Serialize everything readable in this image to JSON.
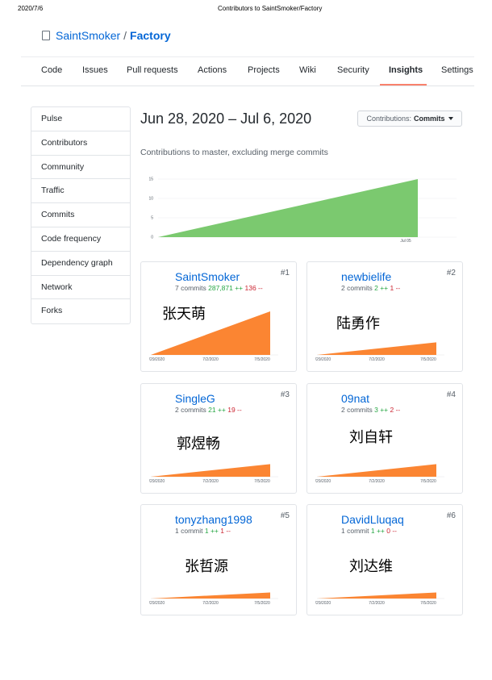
{
  "print_header": {
    "date": "2020/7/6",
    "title": "Contributors to SaintSmoker/Factory"
  },
  "repo": {
    "owner": "SaintSmoker",
    "separator": "/",
    "name": "Factory"
  },
  "tabs": [
    {
      "label": "Code"
    },
    {
      "label": "Issues"
    },
    {
      "label": "Pull requests"
    },
    {
      "label": "Actions"
    },
    {
      "label": "Projects"
    },
    {
      "label": "Wiki"
    },
    {
      "label": "Security"
    },
    {
      "label": "Insights"
    },
    {
      "label": "Settings"
    }
  ],
  "active_tab": "Insights",
  "sidebar": {
    "items": [
      {
        "label": "Pulse"
      },
      {
        "label": "Contributors"
      },
      {
        "label": "Community"
      },
      {
        "label": "Traffic"
      },
      {
        "label": "Commits"
      },
      {
        "label": "Code frequency"
      },
      {
        "label": "Dependency graph"
      },
      {
        "label": "Network"
      },
      {
        "label": "Forks"
      }
    ]
  },
  "main": {
    "date_range": "Jun 28, 2020 – Jul 6, 2020",
    "contrib_button": {
      "prefix": "Contributions:",
      "value": "Commits"
    },
    "subtitle": "Contributions to master, excluding merge commits"
  },
  "chart_data": {
    "type": "area",
    "y_ticks": [
      "15",
      "10",
      "5",
      "0"
    ],
    "x_ticks": [
      "Jul 05"
    ],
    "ylim": [
      0,
      15
    ],
    "points": [
      [
        "Jun 28",
        0
      ],
      [
        "Jul 6",
        15
      ]
    ],
    "color": "#7bc96f"
  },
  "contributors": [
    {
      "rank": "#1",
      "name": "SaintSmoker",
      "commits": "7 commits",
      "additions": "287,871 ++",
      "deletions": "136 --",
      "annotation": "张天萌",
      "peak": 1.0
    },
    {
      "rank": "#2",
      "name": "newbielife",
      "commits": "2 commits",
      "additions": "2 ++",
      "deletions": "1 --",
      "annotation": "陆勇作",
      "peak": 0.29
    },
    {
      "rank": "#3",
      "name": "SingleG",
      "commits": "2 commits",
      "additions": "21 ++",
      "deletions": "19 --",
      "annotation": "郭煜畅",
      "peak": 0.29
    },
    {
      "rank": "#4",
      "name": "09nat",
      "commits": "2 commits",
      "additions": "3 ++",
      "deletions": "2 --",
      "annotation": "刘自轩",
      "peak": 0.29
    },
    {
      "rank": "#5",
      "name": "tonyzhang1998",
      "commits": "1 commit",
      "additions": "1 ++",
      "deletions": "1 --",
      "annotation": "张哲源",
      "peak": 0.14
    },
    {
      "rank": "#6",
      "name": "DavidLluqaq",
      "commits": "1 commit",
      "additions": "1 ++",
      "deletions": "0 --",
      "annotation": "刘达维",
      "peak": 0.14
    }
  ],
  "card_x_ticks": [
    "6/29/2020",
    "7/2/2020",
    "7/5/2020"
  ],
  "colors": {
    "accent": "#0366d6",
    "card_area": "#fb8532",
    "tab_underline": "#f9826c",
    "add": "#28a745",
    "del": "#cb2431"
  }
}
